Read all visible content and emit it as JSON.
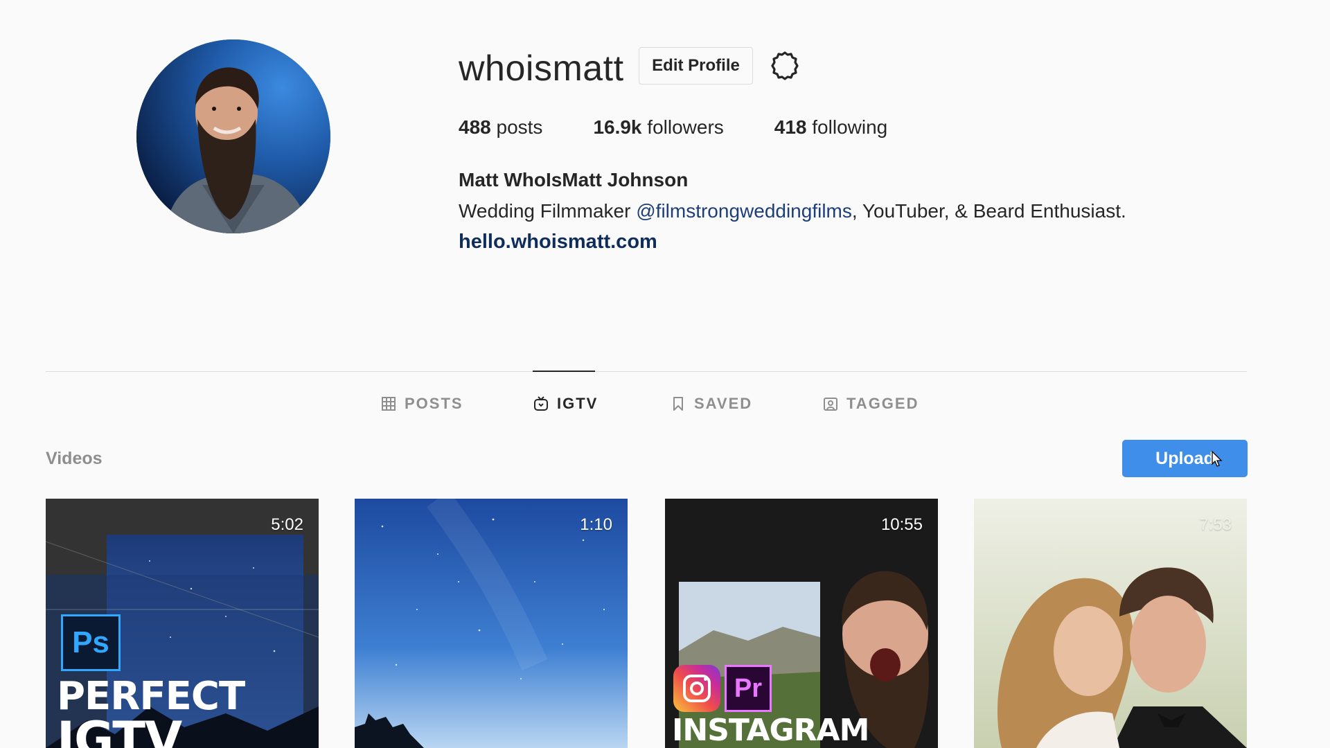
{
  "profile": {
    "username": "whoismatt",
    "edit_button": "Edit Profile",
    "stats": {
      "posts_count": "488",
      "posts_label": "posts",
      "followers_count": "16.9k",
      "followers_label": "followers",
      "following_count": "418",
      "following_label": "following"
    },
    "full_name": "Matt WhoIsMatt Johnson",
    "bio_prefix": "Wedding Filmmaker ",
    "bio_mention": "@filmstrongweddingfilms",
    "bio_suffix": ", YouTuber, & Beard Enthusiast.",
    "website": "hello.whoismatt.com"
  },
  "tabs": [
    {
      "label": "POSTS",
      "icon": "grid-icon",
      "active": false
    },
    {
      "label": "IGTV",
      "icon": "igtv-icon",
      "active": true
    },
    {
      "label": "SAVED",
      "icon": "bookmark-icon",
      "active": false
    },
    {
      "label": "TAGGED",
      "icon": "tagged-icon",
      "active": false
    }
  ],
  "videos": {
    "section_label": "Videos",
    "upload_button": "Upload",
    "items": [
      {
        "duration": "5:02",
        "badge": "Ps",
        "title_lines": [
          "PERFECT",
          "IGTV"
        ]
      },
      {
        "duration": "1:10"
      },
      {
        "duration": "10:55",
        "badge_ig": "instagram-logo",
        "badge": "Pr",
        "title_lines": [
          "INSTAGRAM"
        ]
      },
      {
        "duration": "7:53"
      }
    ]
  },
  "colors": {
    "accent": "#3f8ee9",
    "link": "#1d3e7a",
    "muted": "#8e8e8e",
    "text": "#262626"
  }
}
